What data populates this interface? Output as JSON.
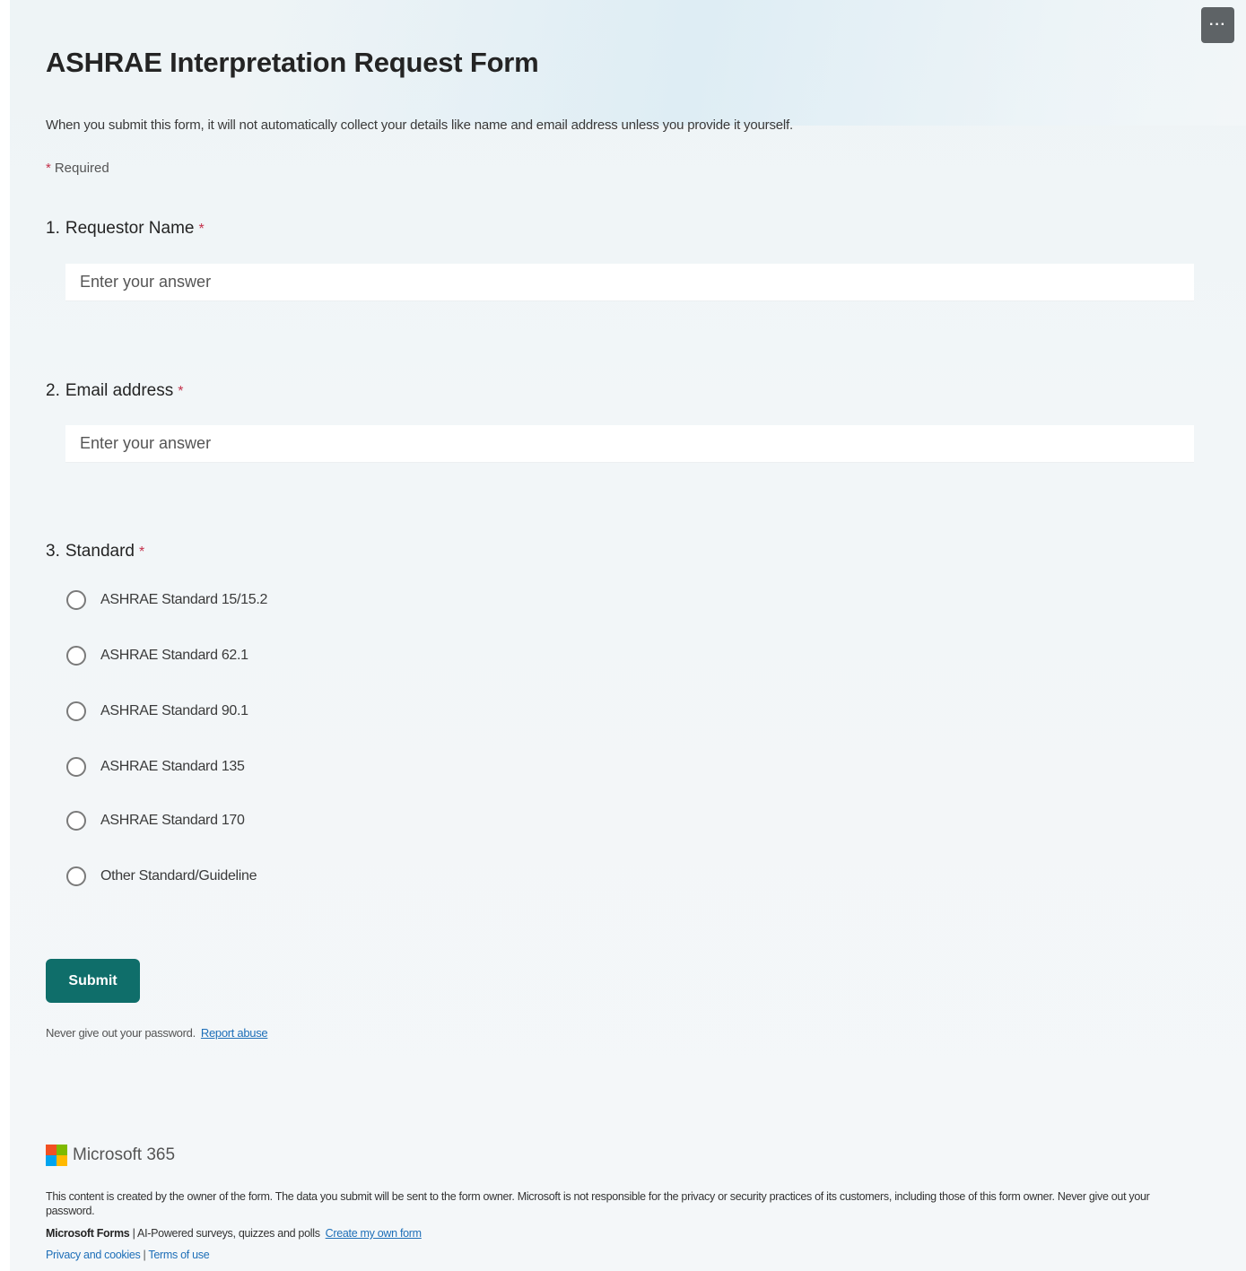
{
  "more_button_label": "···",
  "form": {
    "title": "ASHRAE Interpretation Request Form",
    "description": "When you submit this form, it will not automatically collect your details like name and email address unless you provide it yourself.",
    "required_star": "*",
    "required_label": "Required"
  },
  "questions": [
    {
      "number": "1.",
      "title": "Requestor Name",
      "star": "*",
      "placeholder": "Enter your answer",
      "value": ""
    },
    {
      "number": "2.",
      "title": "Email address",
      "star": "*",
      "placeholder": "Enter your answer",
      "value": ""
    },
    {
      "number": "3.",
      "title": "Standard",
      "star": "*",
      "options": [
        "ASHRAE Standard 15/15.2",
        "ASHRAE Standard 62.1",
        "ASHRAE Standard 90.1",
        "ASHRAE Standard 135",
        "ASHRAE Standard 170",
        "Other Standard/Guideline"
      ]
    }
  ],
  "submit_label": "Submit",
  "security_note": {
    "text": "Never give out your password.",
    "link": "Report abuse"
  },
  "footer": {
    "brand": "Microsoft 365",
    "disclaimer": "This content is created by the owner of the form. The data you submit will be sent to the form owner. Microsoft is not responsible for the privacy or security practices of its customers, including those of this form owner. Never give out your password.",
    "product": "Microsoft Forms",
    "tagline": "| AI-Powered surveys, quizzes and polls",
    "create_link": "Create my own form",
    "privacy_link": "Privacy and cookies",
    "separator": "|",
    "terms_link": "Terms of use"
  }
}
